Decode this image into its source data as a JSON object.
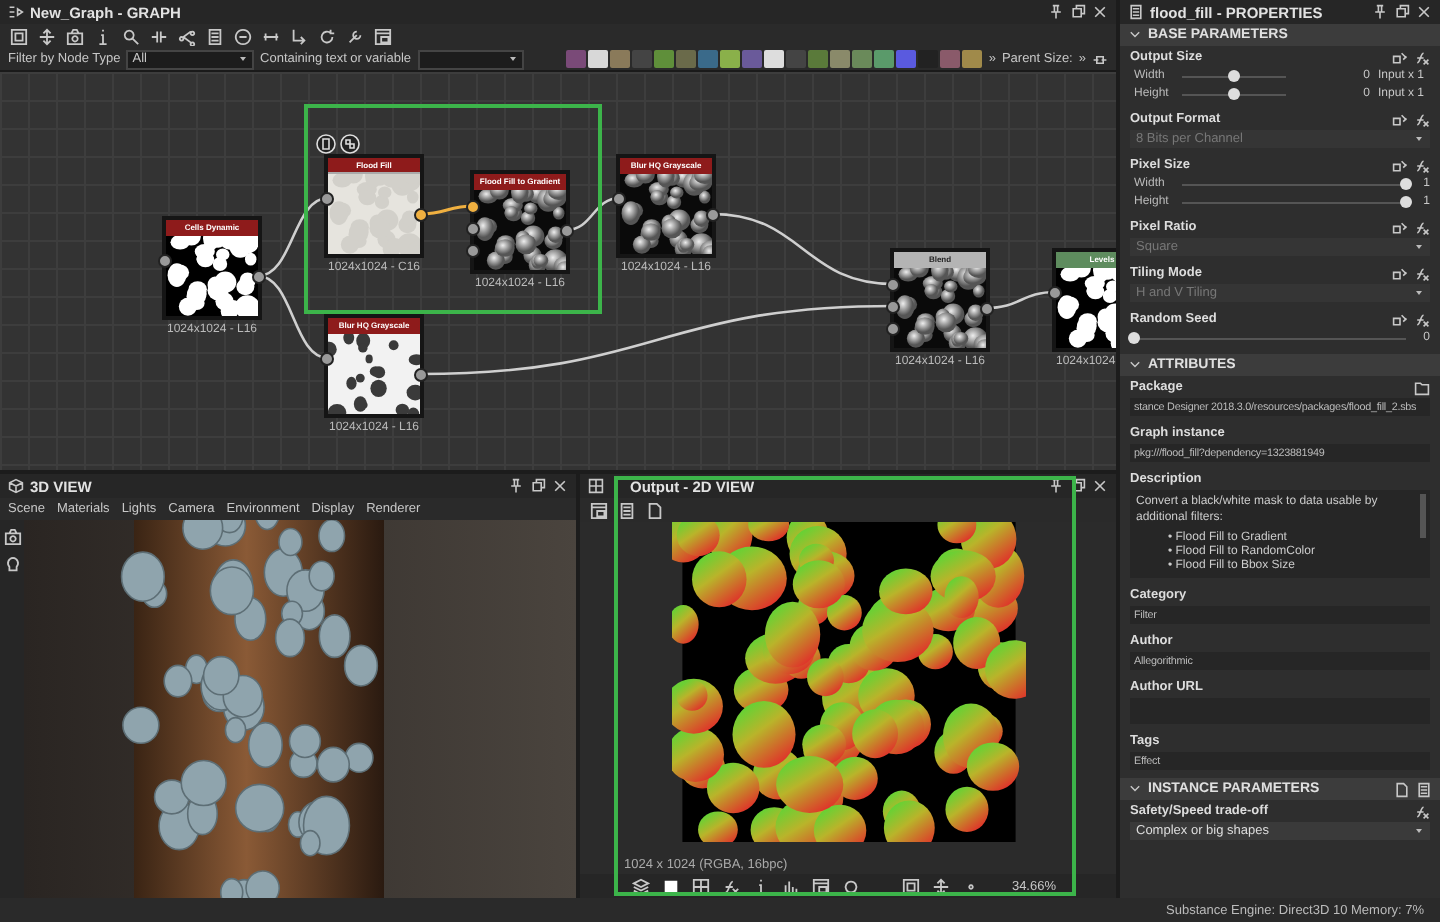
{
  "graph": {
    "title": "New_Graph - GRAPH",
    "highlighted": true,
    "filter": {
      "label": "Filter by Node Type",
      "value": "All",
      "text_label": "Containing text or variable",
      "more": "»",
      "parent_size": "Parent Size:",
      "more_2": "»"
    },
    "nodes": [
      {
        "title": "Cells Dynamic",
        "size": "1024x1024 - L16",
        "color": "#8e1b1b",
        "kind": "cells",
        "selected": false
      },
      {
        "title": "Flood Fill",
        "size": "1024x1024 - C16",
        "color": "#8e1b1b",
        "kind": "flat",
        "selected": true
      },
      {
        "title": "Flood Fill to Gradient",
        "size": "1024x1024 - L16",
        "color": "#8e1b1b",
        "kind": "shaded",
        "selected": false
      },
      {
        "title": "Blur HQ Grayscale",
        "size": "1024x1024 - L16",
        "color": "#8e1b1b",
        "kind": "shaded",
        "selected": false
      },
      {
        "title": "Blur HQ Grayscale",
        "size": "1024x1024 - L16",
        "color": "#8e1b1b",
        "kind": "soft",
        "selected": false
      },
      {
        "title": "Blend",
        "size": "1024x1024 - L16",
        "color": "#b4b4b4",
        "kind": "shaded",
        "selected": false
      },
      {
        "title": "Levels",
        "size": "1024x1024",
        "color": "#5e8c5e",
        "kind": "cells",
        "selected": false
      }
    ]
  },
  "view_3d": {
    "title": "3D VIEW",
    "menu": [
      "Scene",
      "Materials",
      "Lights",
      "Camera",
      "Environment",
      "Display",
      "Renderer"
    ]
  },
  "view_2d": {
    "title": "Output - 2D VIEW",
    "resolution": "1024 x 1024 (RGBA, 16bpc)",
    "zoom": "34.66%",
    "highlighted": true
  },
  "properties": {
    "title": "flood_fill - PROPERTIES",
    "sections": [
      {
        "title": "BASE PARAMETERS",
        "expanded": true,
        "items": [
          {
            "kind": "slider_group",
            "label": "Output Size",
            "rows": [
              {
                "label": "Width",
                "level": 0.5,
                "value": "0",
                "suffix": "Input x 1"
              },
              {
                "label": "Height",
                "level": 0.5,
                "value": "0",
                "suffix": "Input x 1"
              }
            ]
          },
          {
            "kind": "dropdown",
            "label": "Output Format",
            "value": "8 Bits per Channel",
            "disabled": true
          },
          {
            "kind": "slider_group",
            "label": "Pixel Size",
            "rows": [
              {
                "label": "Width",
                "level": 1,
                "value": "1"
              },
              {
                "label": "Height",
                "level": 1,
                "value": "1"
              }
            ]
          },
          {
            "kind": "dropdown",
            "label": "Pixel Ratio",
            "value": "Square",
            "disabled": true
          },
          {
            "kind": "dropdown",
            "label": "Tiling Mode",
            "value": "H and V Tiling",
            "disabled": true
          },
          {
            "kind": "slider_group",
            "label": "Random Seed",
            "rows": [
              {
                "level": 0,
                "value": "0"
              }
            ]
          }
        ]
      },
      {
        "title": "ATTRIBUTES",
        "expanded": true,
        "items": [
          {
            "kind": "file_field",
            "label": "Package",
            "value": "stance Designer 2018.3.0/resources/packages/flood_fill_2.sbs"
          },
          {
            "kind": "field",
            "label": "Graph instance",
            "value": "pkg:///flood_fill?dependency=1323881949"
          },
          {
            "kind": "textarea",
            "label": "Description",
            "text": "Convert a black/white mask to data usable by additional filters:",
            "bullets": [
              "• Flood Fill to Gradient",
              "• Flood Fill to RandomColor",
              "• Flood Fill to Bbox Size"
            ]
          },
          {
            "kind": "field",
            "label": "Category",
            "value": "Filter"
          },
          {
            "kind": "field",
            "label": "Author",
            "value": "Allegorithmic"
          },
          {
            "kind": "field",
            "label": "Author URL"
          },
          {
            "kind": "field",
            "label": "Tags",
            "value": "Effect"
          }
        ]
      },
      {
        "title": "INSTANCE PARAMETERS",
        "expanded": true,
        "items": [
          {
            "kind": "dropdown",
            "label": "Safety/Speed trade-off",
            "value": "Complex or big shapes",
            "disabled": false
          }
        ]
      }
    ]
  },
  "status_bar": "Substance Engine: Direct3D 10  Memory: 7%"
}
